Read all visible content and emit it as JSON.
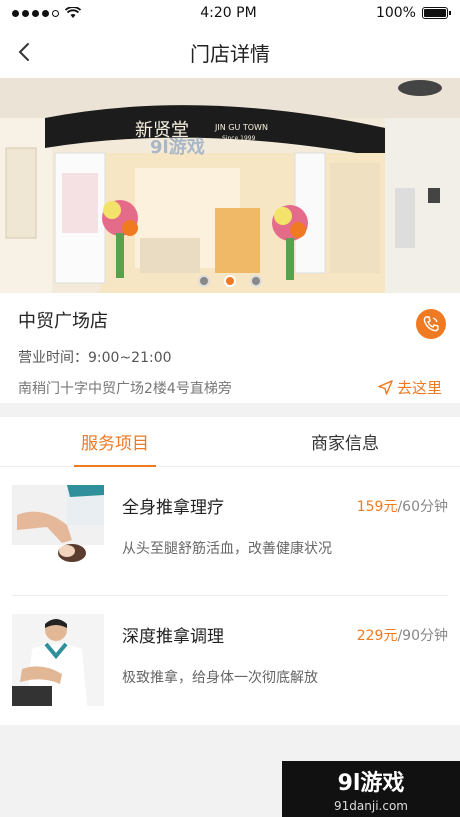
{
  "status": {
    "time": "4:20 PM",
    "battery": "100%"
  },
  "nav": {
    "title": "门店详情"
  },
  "hero": {
    "sign_main": "新贤堂",
    "sign_sub": "JIN GU TOWN",
    "sign_since": "Since 1999",
    "watermark": "9l游戏"
  },
  "store": {
    "name": "中贸广场店",
    "hours": "营业时间：9:00~21:00",
    "address": "南稍门十字中贸广场2楼4号直梯旁",
    "go_label": "去这里"
  },
  "tabs": [
    {
      "label": "服务项目"
    },
    {
      "label": "商家信息"
    }
  ],
  "services": [
    {
      "name": "全身推拿理疗",
      "price": "159元",
      "duration": "/60分钟",
      "desc": "从头至腿舒筋活血，改善健康状况"
    },
    {
      "name": "深度推拿调理",
      "price": "229元",
      "duration": "/90分钟",
      "desc": "极致推拿，给身体一次彻底解放"
    }
  ],
  "watermark": {
    "main": "9l游戏",
    "sub": "91danji.com"
  },
  "colors": {
    "accent": "#f07a22"
  }
}
